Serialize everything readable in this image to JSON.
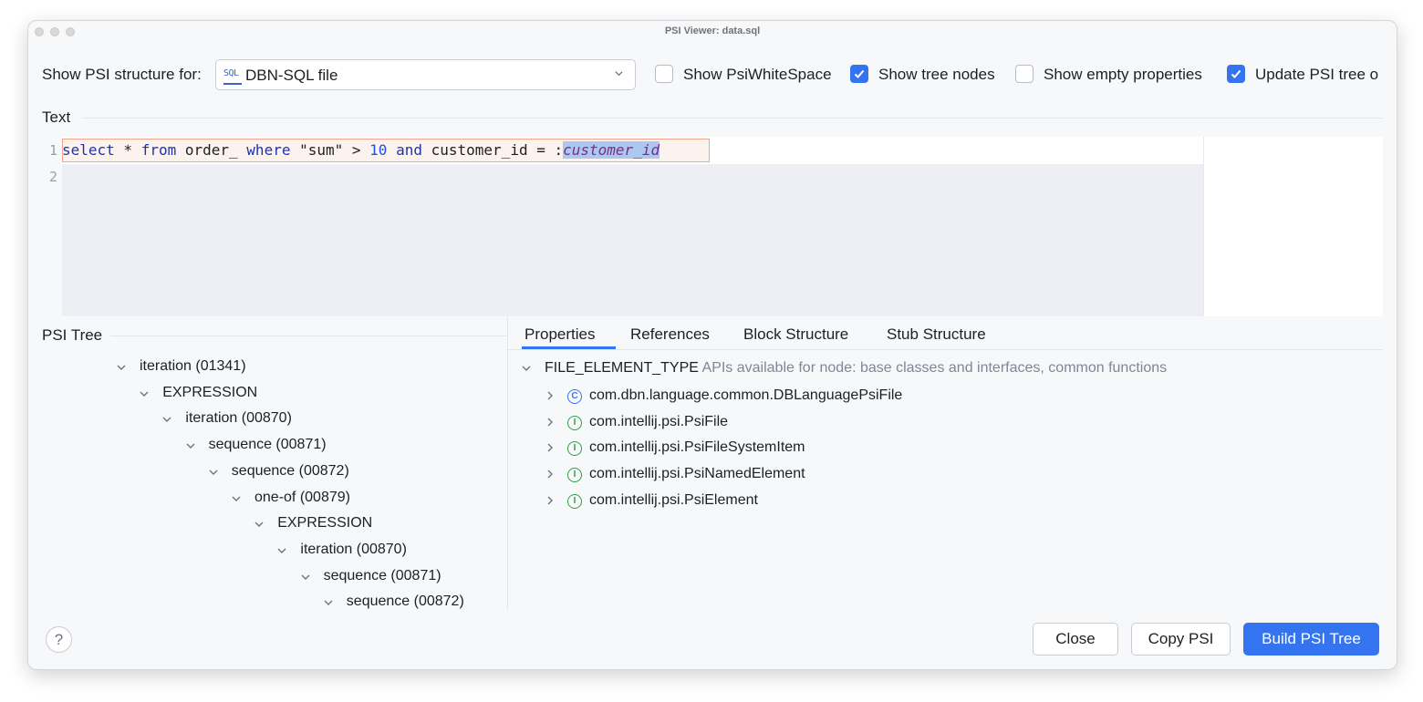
{
  "window": {
    "title": "PSI Viewer: data.sql"
  },
  "toolbar": {
    "show_for_label": "Show PSI structure for:",
    "file_type": {
      "icon": "sql-file-icon",
      "value": "DBN-SQL file"
    },
    "checkboxes": [
      {
        "label": "Show PsiWhiteSpace",
        "checked": false
      },
      {
        "label": "Show tree nodes",
        "checked": true
      },
      {
        "label": "Show empty properties",
        "checked": false
      },
      {
        "label": "Update PSI tree o",
        "checked": true
      }
    ]
  },
  "text_section": {
    "label": "Text"
  },
  "editor": {
    "line_numbers": [
      "1",
      "2"
    ],
    "tokens": {
      "t1": "select",
      "t2": " * ",
      "t3": "from",
      "t4": " order_ ",
      "t5": "where",
      "t6": " \"sum\" > ",
      "t7": "10",
      "t8": " ",
      "t9": "and",
      "t10": " customer_id = :",
      "t11": "customer_id"
    }
  },
  "psi_tree": {
    "label": "PSI Tree",
    "nodes": [
      {
        "text": "iteration (01341)",
        "depth": 0
      },
      {
        "text": "EXPRESSION",
        "depth": 1
      },
      {
        "text": "iteration (00870)",
        "depth": 2
      },
      {
        "text": "sequence (00871)",
        "depth": 3
      },
      {
        "text": "sequence (00872)",
        "depth": 4
      },
      {
        "text": "one-of (00879)",
        "depth": 5
      },
      {
        "text": "EXPRESSION",
        "depth": 6
      },
      {
        "text": "iteration (00870)",
        "depth": 7
      },
      {
        "text": "sequence (00871)",
        "depth": 8
      },
      {
        "text": "sequence (00872)",
        "depth": 9
      }
    ]
  },
  "tabs": [
    {
      "label": "Properties",
      "selected": true
    },
    {
      "label": "References",
      "selected": false
    },
    {
      "label": "Block Structure",
      "selected": false
    },
    {
      "label": "Stub Structure",
      "selected": false
    }
  ],
  "properties": {
    "root": {
      "name": "FILE_ELEMENT_TYPE",
      "description": "APIs available for node: base classes and interfaces, common functions"
    },
    "items": [
      {
        "icon": "class-icon",
        "glyph": "C",
        "text": "com.dbn.language.common.DBLanguagePsiFile"
      },
      {
        "icon": "interface-icon",
        "glyph": "I",
        "text": "com.intellij.psi.PsiFile"
      },
      {
        "icon": "interface-icon",
        "glyph": "I",
        "text": "com.intellij.psi.PsiFileSystemItem"
      },
      {
        "icon": "interface-icon",
        "glyph": "I",
        "text": "com.intellij.psi.PsiNamedElement"
      },
      {
        "icon": "interface-icon",
        "glyph": "I",
        "text": "com.intellij.psi.PsiElement"
      }
    ]
  },
  "footer": {
    "help": "?",
    "close": "Close",
    "copy": "Copy PSI",
    "build": "Build PSI Tree"
  }
}
